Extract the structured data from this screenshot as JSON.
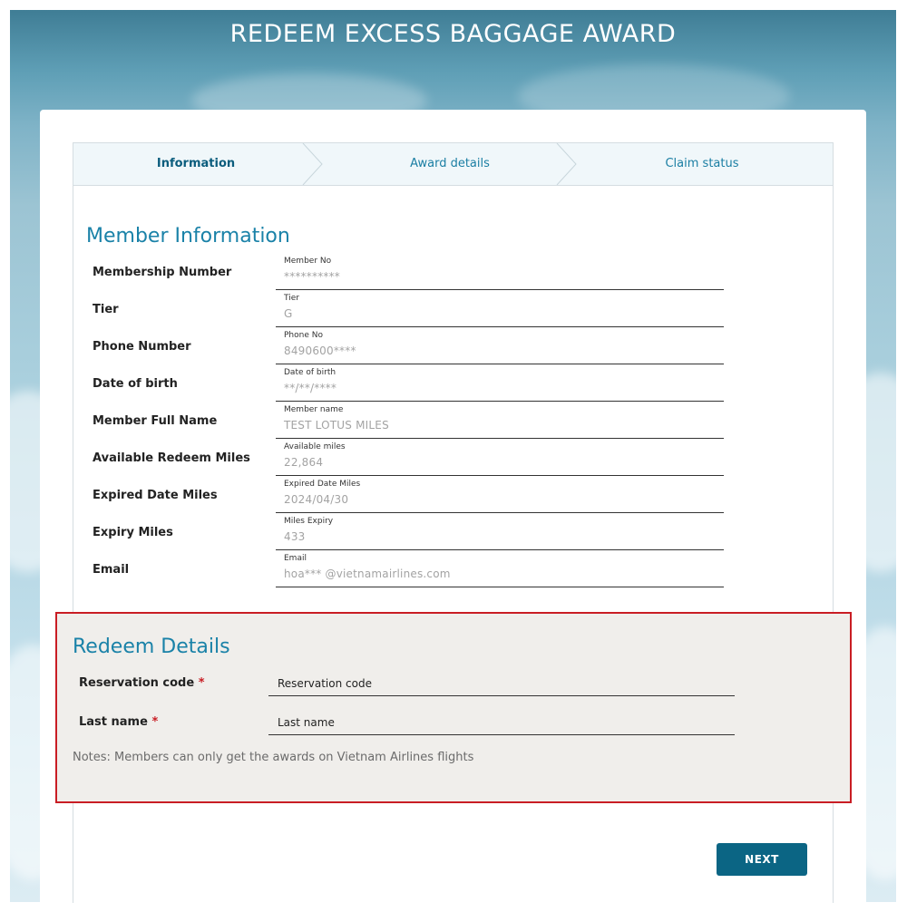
{
  "page_title": "REDEEM EXCESS BAGGAGE AWARD",
  "steps": [
    {
      "label": "Information",
      "active": true
    },
    {
      "label": "Award details",
      "active": false
    },
    {
      "label": "Claim status",
      "active": false
    }
  ],
  "member_info": {
    "title": "Member Information",
    "rows": [
      {
        "label": "Membership Number",
        "field_label": "Member No",
        "value": "**********"
      },
      {
        "label": "Tier",
        "field_label": "Tier",
        "value": "G"
      },
      {
        "label": "Phone Number",
        "field_label": "Phone No",
        "value": "8490600****"
      },
      {
        "label": "Date of birth",
        "field_label": "Date of birth",
        "value": "**/**/****"
      },
      {
        "label": "Member Full Name",
        "field_label": "Member name",
        "value": "TEST LOTUS MILES"
      },
      {
        "label": "Available Redeem Miles",
        "field_label": "Available miles",
        "value": "22,864"
      },
      {
        "label": "Expired Date Miles",
        "field_label": "Expired Date Miles",
        "value": "2024/04/30"
      },
      {
        "label": "Expiry Miles",
        "field_label": "Miles Expiry",
        "value": "433"
      },
      {
        "label": "Email",
        "field_label": "Email",
        "value": "hoa*** @vietnamairlines.com"
      }
    ]
  },
  "redeem_details": {
    "title": "Redeem Details",
    "reservation_label": "Reservation code",
    "reservation_placeholder": "Reservation code",
    "lastname_label": "Last name",
    "lastname_placeholder": "Last name",
    "required_mark": "*",
    "notes": "Notes: Members can only get the awards on Vietnam Airlines flights"
  },
  "next_button": "NEXT",
  "colors": {
    "accent": "#1a82a8",
    "button": "#0b6584",
    "highlight_border": "#c91d24"
  }
}
